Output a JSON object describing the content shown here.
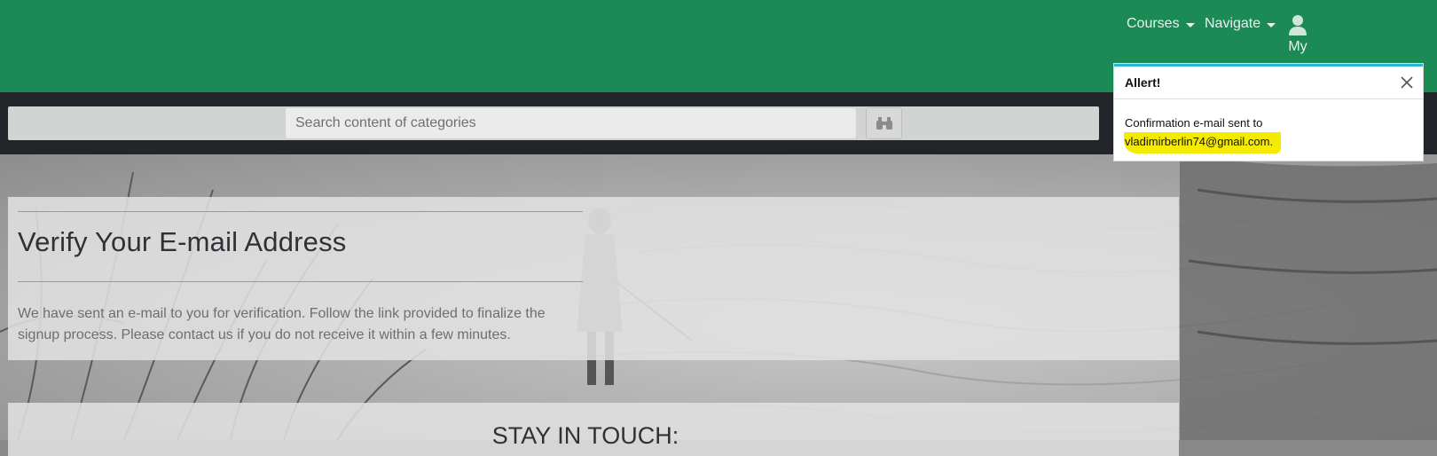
{
  "nav": {
    "courses_label": "Courses",
    "navigate_label": "Navigate",
    "user_label": "My"
  },
  "search": {
    "placeholder": "Search content of categories",
    "button_icon": "binoculars-icon"
  },
  "verify": {
    "title": "Verify Your E-mail Address",
    "body": "We have sent an e-mail to you for verification. Follow the link provided to finalize the signup process. Please contact us if you do not receive it within a few minutes."
  },
  "stay": {
    "title": "STAY IN TOUCH:"
  },
  "toast": {
    "title": "Allert!",
    "message": "Confirmation e-mail sent to",
    "email": "vladimirberlin74@gmail.com."
  },
  "colors": {
    "nav_green": "#1b8a55",
    "search_bar": "#22262b",
    "toast_accent": "#29b6d8",
    "highlight": "#f5eb00"
  }
}
